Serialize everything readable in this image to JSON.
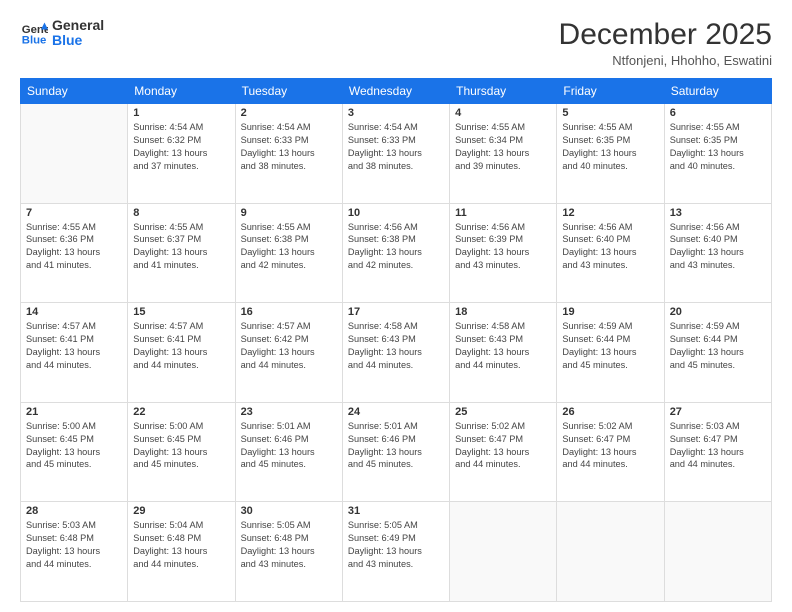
{
  "header": {
    "logo_line1": "General",
    "logo_line2": "Blue",
    "title": "December 2025",
    "location": "Ntfonjeni, Hhohho, Eswatini"
  },
  "weekdays": [
    "Sunday",
    "Monday",
    "Tuesday",
    "Wednesday",
    "Thursday",
    "Friday",
    "Saturday"
  ],
  "weeks": [
    [
      {
        "day": "",
        "info": ""
      },
      {
        "day": "1",
        "info": "Sunrise: 4:54 AM\nSunset: 6:32 PM\nDaylight: 13 hours\nand 37 minutes."
      },
      {
        "day": "2",
        "info": "Sunrise: 4:54 AM\nSunset: 6:33 PM\nDaylight: 13 hours\nand 38 minutes."
      },
      {
        "day": "3",
        "info": "Sunrise: 4:54 AM\nSunset: 6:33 PM\nDaylight: 13 hours\nand 38 minutes."
      },
      {
        "day": "4",
        "info": "Sunrise: 4:55 AM\nSunset: 6:34 PM\nDaylight: 13 hours\nand 39 minutes."
      },
      {
        "day": "5",
        "info": "Sunrise: 4:55 AM\nSunset: 6:35 PM\nDaylight: 13 hours\nand 40 minutes."
      },
      {
        "day": "6",
        "info": "Sunrise: 4:55 AM\nSunset: 6:35 PM\nDaylight: 13 hours\nand 40 minutes."
      }
    ],
    [
      {
        "day": "7",
        "info": "Sunrise: 4:55 AM\nSunset: 6:36 PM\nDaylight: 13 hours\nand 41 minutes."
      },
      {
        "day": "8",
        "info": "Sunrise: 4:55 AM\nSunset: 6:37 PM\nDaylight: 13 hours\nand 41 minutes."
      },
      {
        "day": "9",
        "info": "Sunrise: 4:55 AM\nSunset: 6:38 PM\nDaylight: 13 hours\nand 42 minutes."
      },
      {
        "day": "10",
        "info": "Sunrise: 4:56 AM\nSunset: 6:38 PM\nDaylight: 13 hours\nand 42 minutes."
      },
      {
        "day": "11",
        "info": "Sunrise: 4:56 AM\nSunset: 6:39 PM\nDaylight: 13 hours\nand 43 minutes."
      },
      {
        "day": "12",
        "info": "Sunrise: 4:56 AM\nSunset: 6:40 PM\nDaylight: 13 hours\nand 43 minutes."
      },
      {
        "day": "13",
        "info": "Sunrise: 4:56 AM\nSunset: 6:40 PM\nDaylight: 13 hours\nand 43 minutes."
      }
    ],
    [
      {
        "day": "14",
        "info": "Sunrise: 4:57 AM\nSunset: 6:41 PM\nDaylight: 13 hours\nand 44 minutes."
      },
      {
        "day": "15",
        "info": "Sunrise: 4:57 AM\nSunset: 6:41 PM\nDaylight: 13 hours\nand 44 minutes."
      },
      {
        "day": "16",
        "info": "Sunrise: 4:57 AM\nSunset: 6:42 PM\nDaylight: 13 hours\nand 44 minutes."
      },
      {
        "day": "17",
        "info": "Sunrise: 4:58 AM\nSunset: 6:43 PM\nDaylight: 13 hours\nand 44 minutes."
      },
      {
        "day": "18",
        "info": "Sunrise: 4:58 AM\nSunset: 6:43 PM\nDaylight: 13 hours\nand 44 minutes."
      },
      {
        "day": "19",
        "info": "Sunrise: 4:59 AM\nSunset: 6:44 PM\nDaylight: 13 hours\nand 45 minutes."
      },
      {
        "day": "20",
        "info": "Sunrise: 4:59 AM\nSunset: 6:44 PM\nDaylight: 13 hours\nand 45 minutes."
      }
    ],
    [
      {
        "day": "21",
        "info": "Sunrise: 5:00 AM\nSunset: 6:45 PM\nDaylight: 13 hours\nand 45 minutes."
      },
      {
        "day": "22",
        "info": "Sunrise: 5:00 AM\nSunset: 6:45 PM\nDaylight: 13 hours\nand 45 minutes."
      },
      {
        "day": "23",
        "info": "Sunrise: 5:01 AM\nSunset: 6:46 PM\nDaylight: 13 hours\nand 45 minutes."
      },
      {
        "day": "24",
        "info": "Sunrise: 5:01 AM\nSunset: 6:46 PM\nDaylight: 13 hours\nand 45 minutes."
      },
      {
        "day": "25",
        "info": "Sunrise: 5:02 AM\nSunset: 6:47 PM\nDaylight: 13 hours\nand 44 minutes."
      },
      {
        "day": "26",
        "info": "Sunrise: 5:02 AM\nSunset: 6:47 PM\nDaylight: 13 hours\nand 44 minutes."
      },
      {
        "day": "27",
        "info": "Sunrise: 5:03 AM\nSunset: 6:47 PM\nDaylight: 13 hours\nand 44 minutes."
      }
    ],
    [
      {
        "day": "28",
        "info": "Sunrise: 5:03 AM\nSunset: 6:48 PM\nDaylight: 13 hours\nand 44 minutes."
      },
      {
        "day": "29",
        "info": "Sunrise: 5:04 AM\nSunset: 6:48 PM\nDaylight: 13 hours\nand 44 minutes."
      },
      {
        "day": "30",
        "info": "Sunrise: 5:05 AM\nSunset: 6:48 PM\nDaylight: 13 hours\nand 43 minutes."
      },
      {
        "day": "31",
        "info": "Sunrise: 5:05 AM\nSunset: 6:49 PM\nDaylight: 13 hours\nand 43 minutes."
      },
      {
        "day": "",
        "info": ""
      },
      {
        "day": "",
        "info": ""
      },
      {
        "day": "",
        "info": ""
      }
    ]
  ]
}
